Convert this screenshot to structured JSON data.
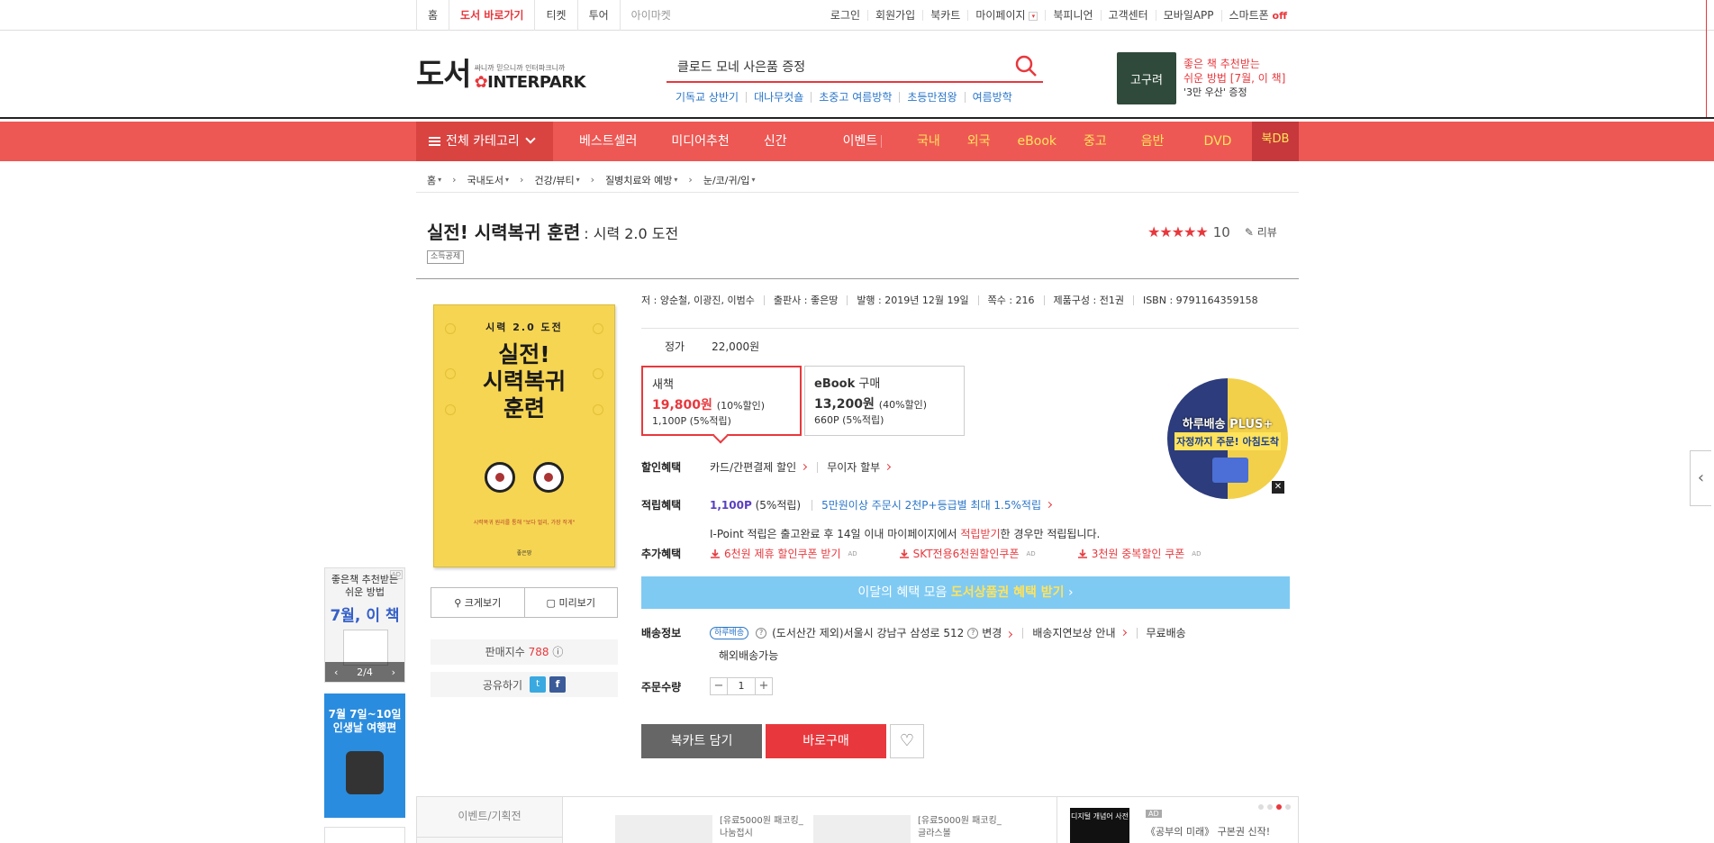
{
  "topbar": {
    "left": [
      "홈",
      "도서 바로가기",
      "티켓",
      "투어",
      "아이마켓"
    ],
    "right": [
      "로그인",
      "회원가입",
      "북카트",
      "마이페이지",
      "북피니언",
      "고객센터",
      "모바일APP",
      "스마트폰"
    ],
    "smartphone_status": "off"
  },
  "header": {
    "logo_kr": "도서",
    "logo_tagline": "싸니까 믿으니까 인터파크니까",
    "logo_brand": "INTERPARK",
    "search_value": "클로드 모네 사은품 증정",
    "keywords": [
      "기독교 상반기",
      "대나무컷숄",
      "초중고 여름방학",
      "초등만점왕",
      "여름방학"
    ],
    "ad": {
      "book_title": "고구려",
      "line1": "좋은 책 추천받는",
      "line2": "쉬운 방법 [7월, 이 책]",
      "line3": "'3만 우산' 증정"
    }
  },
  "nav": {
    "category": "전체 카테고리",
    "menu_a": [
      "베스트셀러",
      "미디어추천",
      "신간",
      "이벤트"
    ],
    "menu_b": [
      "국내",
      "외국",
      "eBook",
      "중고",
      "음반",
      "DVD"
    ],
    "bookdb": "북DB"
  },
  "breadcrumb": [
    "홈",
    "국내도서",
    "건강/뷰티",
    "질병치료와 예방",
    "눈/코/귀/입"
  ],
  "product": {
    "title": "실전! 시력복귀 훈련",
    "subtitle": ": 시력 2.0 도전",
    "tag": "소득공제",
    "stars": "★★★★★",
    "score": "10",
    "review": "리뷰",
    "meta": [
      "저 : 양순철, 이광진, 이범수",
      "출판사 : 좋은땅",
      "발행 : 2019년 12월 19일",
      "쪽수 : 216",
      "제품구성 : 전1권",
      "ISBN : 9791164359158"
    ],
    "cover": {
      "top": "시력 2.0 도전",
      "title_line1": "실전!",
      "title_line2": "시력복귀",
      "title_line3": "훈련",
      "small": "시력복귀 원리를 통해 \"보다 멀리, 가장 작게\"",
      "authors": "좋은땅"
    },
    "enlarge": "크게보기",
    "preview": "미리보기",
    "sales_label": "판매지수",
    "sales_value": "788",
    "share_label": "공유하기",
    "price_label": "정가",
    "price_value": "22,000원",
    "new_book": {
      "type": "새책",
      "price": "19,800원",
      "discount": "(10%할인)",
      "points": "1,100P (5%적립)"
    },
    "ebook": {
      "type_brand": "eBook",
      "type_word": "구매",
      "price": "13,200원",
      "discount": "(40%할인)",
      "points": "660P (5%적립)"
    },
    "badge_ad": {
      "title": "하루배송 PLUS+",
      "sub": "자정까지 주문! 아침도착"
    },
    "discount_benefit": {
      "label": "할인혜택",
      "items": [
        "카드/간편결제 할인",
        "무이자 할부"
      ]
    },
    "point_benefit": {
      "label": "적립혜택",
      "points": "1,100P",
      "pct": "(5%적립)",
      "extra": "5만원이상 주문시 2천P+등급별 최대 1.5%적립"
    },
    "ipoint": {
      "pre": "I-Point 적립은 출고완료 후 14일 이내 마이페이지에서",
      "hl": "적립받기",
      "post": "한 경우만 적립됩니다."
    },
    "extra_benefit": {
      "label": "추가혜택",
      "coupons": [
        "6천원 제휴 할인쿠폰 받기",
        "SKT전용6천원할인쿠폰",
        "3천원 중복할인 쿠폰"
      ],
      "ad": "AD"
    },
    "benefit_bar": {
      "pre": "이달의 혜택 모음",
      "hl": "도서상품권 혜택 받기"
    },
    "delivery": {
      "label": "배송정보",
      "tag": "하루배송",
      "note": "(도서산간 제외)",
      "address": "서울시 강남구 삼성로 512",
      "change": "변경",
      "delay": "배송지연보상 안내",
      "free": "무료배송",
      "overseas": "해외배송가능"
    },
    "qty": {
      "label": "주문수량",
      "value": "1"
    },
    "cart_button": "북카트 담기",
    "buy_button": "바로구매"
  },
  "side_ads": {
    "ad1_line1": "좋은책 추천받는",
    "ad1_line2": "쉬운 방법",
    "ad1_title": "7월, 이 책",
    "ad1_counter": "2/4",
    "ad1_tag": "AD",
    "ad2_line1": "7월 7일~10일",
    "ad2_line2": "인생날 여행편"
  },
  "bottom": {
    "tab": "이벤트/기획전",
    "products": [
      {
        "line1": "[유료5000원 패코킹_",
        "line2": "나눔접시"
      },
      {
        "line1": "[유료5000원 패코킹_",
        "line2": "글라스볼"
      }
    ],
    "ad_book": "디지털 개념어 사전",
    "ad_tag": "AD",
    "ad_text": "《공부의 미래》 구본권 신작!"
  },
  "colors": {
    "accent": "#e8383d",
    "nav": "#ed5854",
    "benefit_bar": "#7fcaf3",
    "link_blue": "#2a76c9"
  }
}
